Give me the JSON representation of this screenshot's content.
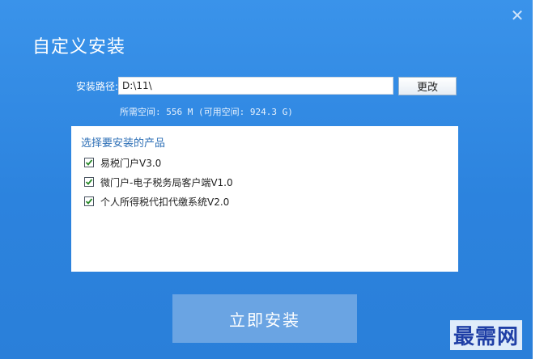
{
  "window": {
    "title": "自定义安装",
    "close_symbol": "✕"
  },
  "install_path": {
    "label": "安装路径:",
    "value": "D:\\11\\",
    "change_label": "更改"
  },
  "space_info": "所需空间: 556 M (可用空间: 924.3 G)",
  "products": {
    "heading": "选择要安装的产品",
    "items": [
      {
        "label": "易税门户V3.0",
        "checked": true
      },
      {
        "label": "微门户-电子税务局客户端V1.0",
        "checked": true
      },
      {
        "label": "个人所得税代扣代缴系统V2.0",
        "checked": true
      }
    ]
  },
  "install_button": "立即安装",
  "watermark": "最需网",
  "colors": {
    "window_bg": "#2f86e0",
    "button_bg": "#6aa4e3",
    "heading_text": "#2d6fb6"
  },
  "icons": {
    "close": "close-icon",
    "checkbox": "checkmark-icon"
  }
}
